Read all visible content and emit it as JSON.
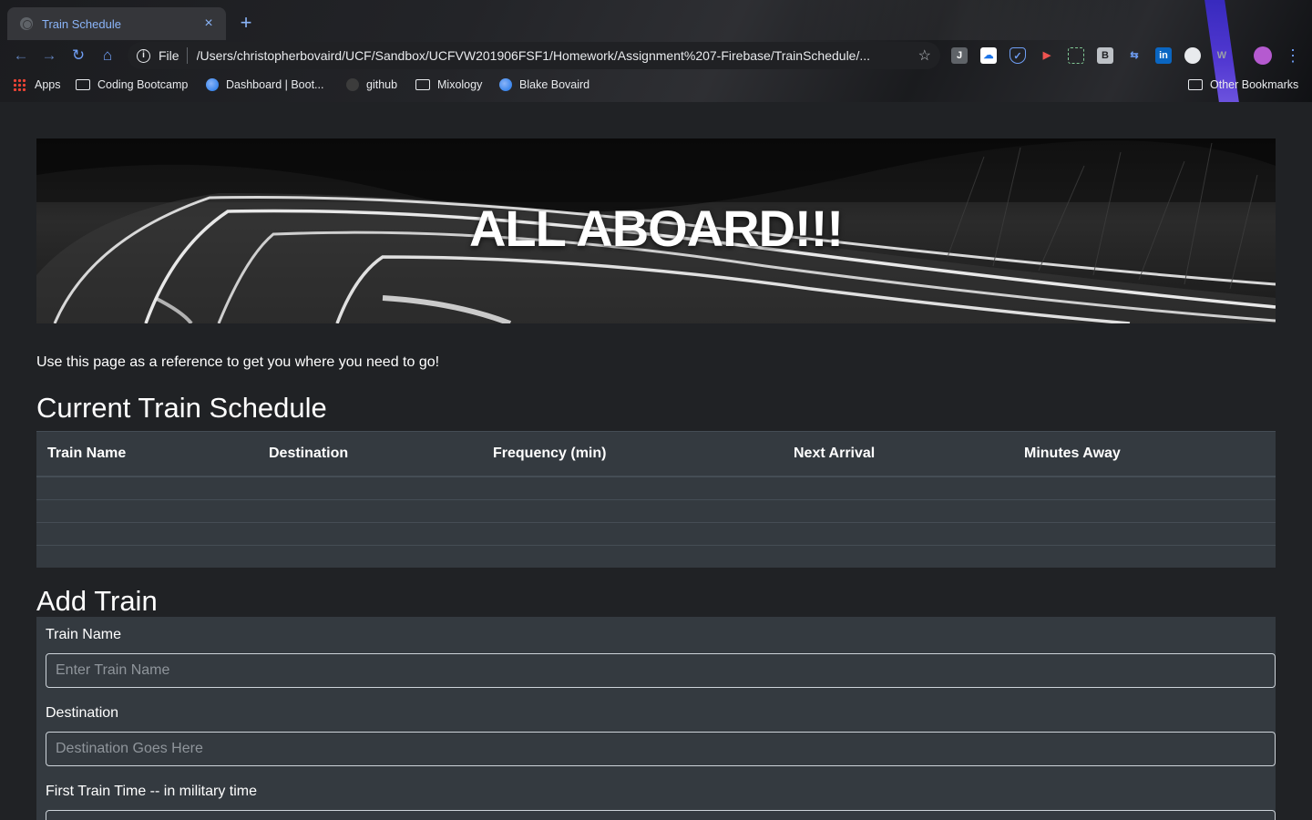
{
  "browser": {
    "tab_title": "Train Schedule",
    "tab_close": "×",
    "new_tab": "+",
    "scheme": "File",
    "url": "/Users/christopherbovaird/UCF/Sandbox/UCFVW201906FSF1/Homework/Assignment%207-Firebase/TrainSchedule/...",
    "bookmarks": [
      "Apps",
      "Coding Bootcamp",
      "Dashboard | Boot...",
      "github",
      "Mixology",
      "Blake Bovaird"
    ],
    "other_bookmarks": "Other Bookmarks",
    "accent_color": "#8ab4f8"
  },
  "page": {
    "hero_title": "ALL ABOARD!!!",
    "lead": "Use this page as a reference to get you where you need to go!",
    "schedule_heading": "Current Train Schedule",
    "columns": [
      "Train Name",
      "Destination",
      "Frequency (min)",
      "Next Arrival",
      "Minutes Away"
    ],
    "add_heading": "Add Train",
    "form": {
      "train_name_label": "Train Name",
      "train_name_placeholder": "Enter Train Name",
      "destination_label": "Destination",
      "destination_placeholder": "Destination Goes Here",
      "first_time_label": "First Train Time -- in military time"
    }
  }
}
